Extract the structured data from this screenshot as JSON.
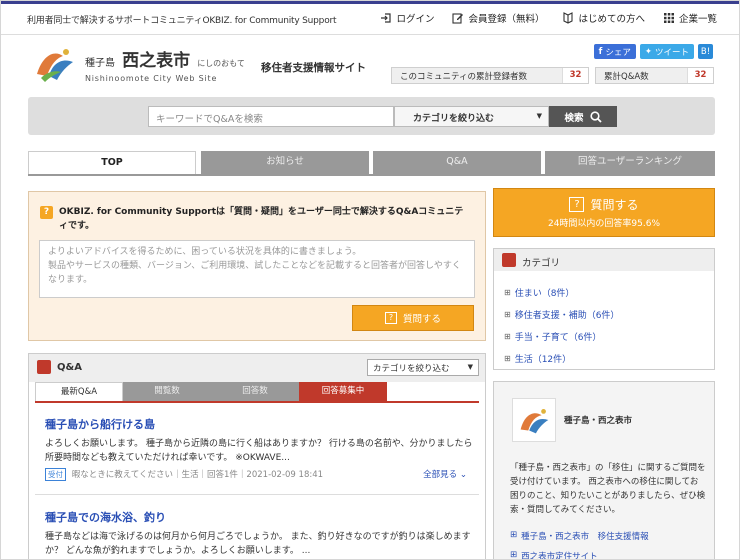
{
  "topbar": {
    "tagline": "利用者同士で解決するサポートコミュニティOKBIZ. for Community Support",
    "nav": {
      "login": "ログイン",
      "register": "会員登録（無料）",
      "beginner": "はじめての方へ",
      "companies": "企業一覧"
    }
  },
  "header": {
    "brand_prefix": "種子島",
    "brand_name": "西之表市",
    "brand_kana": "にしのおもて",
    "brand_roman": "Nishinoomote City Web Site",
    "site_name": "移住者支援情報サイト",
    "share_fb": "シェア",
    "share_tw": "ツイート",
    "share_hatena": "B!",
    "stat_users_label": "このコミュニティの累計登録者数",
    "stat_users_value": "32",
    "stat_qa_label": "累計Q&A数",
    "stat_qa_value": "32"
  },
  "search": {
    "placeholder": "キーワードでQ&Aを検索",
    "category_label": "カテゴリを絞り込む",
    "button": "検索"
  },
  "tabs": [
    "TOP",
    "お知らせ",
    "Q&A",
    "回答ユーザーランキング"
  ],
  "ask": {
    "title": "OKBIZ. for Community Supportは「質問・疑問」をユーザー同士で解決するQ&Aコミュニティです。",
    "placeholder": "よりよいアドバイスを得るために、困っている状況を具体的に書きましょう。\n製品やサービスの種類、バージョン、ご利用環境、試したことなどを記載すると回答者が回答しやすくなります。",
    "button": "質問する"
  },
  "big_ask": {
    "label": "質問する",
    "sub": "24時間以内の回答率95.6%"
  },
  "qa": {
    "title": "Q&A",
    "filter": "カテゴリを絞り込む",
    "tabs": [
      "最新Q&A",
      "閲覧数",
      "回答数",
      "回答募集中"
    ],
    "items": [
      {
        "title": "種子島から船行ける島",
        "body": "よろしくお願いします。 種子島から近隣の島に行く船はありますか？ 行ける島の名前や、分かりましたら所要時間なども教えていただければ幸いです。 ※OKWAVE...",
        "badge": "受付",
        "meta": "暇なときに教えてください｜生活｜回答1件｜2021-02-09 18:41",
        "more": "全部見る"
      },
      {
        "title": "種子島での海水浴、釣り",
        "body": "種子島などは海で泳げるのは何月から何月ごろでしょうか。 また、釣り好きなのですが釣りは楽しめますか？ どんな魚が釣れますでしょうか。よろしくお願いします。 ..."
      }
    ]
  },
  "category": {
    "title": "カテゴリ",
    "items": [
      "住まい（8件）",
      "移住者支援・補助（6件）",
      "手当・子育て（6件）",
      "生活（12件）"
    ]
  },
  "info": {
    "name": "種子島・西之表市",
    "desc": "「種子島・西之表市」の「移住」に関するご質問を受け付けています。 西之表市への移住に関してお困りのこと、知りたいことがありましたら、ぜひ検索・質問してみてください。",
    "link1": "種子島・西之表市　移住支援情報",
    "link2": "西之表市定住サイト"
  },
  "colors": {
    "accent_orange": "#f5a623",
    "accent_red": "#c0392b",
    "link_blue": "#2a4fb5"
  }
}
